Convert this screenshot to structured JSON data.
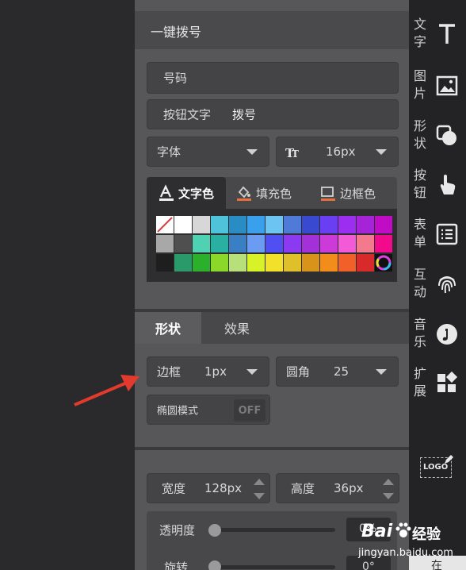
{
  "panel": {
    "title": "一键拨号",
    "number_label": "号码",
    "button_text_label": "按钮文字",
    "button_text_value": "拨号",
    "font_label": "字体",
    "font_size": "16px"
  },
  "color_tabs": [
    {
      "label": "文字色",
      "icon": "text-color-icon"
    },
    {
      "label": "填充色",
      "icon": "fill-color-icon"
    },
    {
      "label": "边框色",
      "icon": "border-color-icon"
    }
  ],
  "palette": {
    "rows": [
      [
        "none",
        "#ffffff",
        "#d7d7d7",
        "#4fc3d9",
        "#2a8cc4",
        "#3aa0ec",
        "#6cc4f2",
        "#4f7ad8",
        "#3a4ad0",
        "#6a3ef2",
        "#9c2ef2",
        "#a624d8",
        "#c00cc4"
      ],
      [
        "#a8a8a8",
        "#4f4f4f",
        "#4fd2b2",
        "#2ab0a0",
        "#3a7ec4",
        "#6c9cf2",
        "#5050f2",
        "#8c3af2",
        "#a430d8",
        "#cc3ad8",
        "#f25ad8",
        "#f27a8c",
        "#f20a8c"
      ],
      [
        "#1e1e1e",
        "#2a9a6a",
        "#2ab02a",
        "#8cd82a",
        "#b8e07a",
        "#d8f22a",
        "#f2e02a",
        "#e0c02a",
        "#d8941a",
        "#f28c1a",
        "#f2602a",
        "#d82a2a",
        "wheel"
      ]
    ]
  },
  "shape_tabs": [
    {
      "label": "形状"
    },
    {
      "label": "效果"
    }
  ],
  "shape": {
    "border_label": "边框",
    "border_value": "1px",
    "radius_label": "圆角",
    "radius_value": "25",
    "ellipse_label": "椭圆模式",
    "ellipse_toggle": "OFF"
  },
  "size": {
    "width_label": "宽度",
    "width_value": "128px",
    "height_label": "高度",
    "height_value": "36px"
  },
  "sliders": {
    "opacity_label": "透明度",
    "opacity_value": "0%",
    "rotate_label": "旋转",
    "rotate_value": "0°"
  },
  "rail": [
    {
      "label": "文字",
      "icon": "text-icon"
    },
    {
      "label": "图片",
      "icon": "image-icon"
    },
    {
      "label": "形状",
      "icon": "shape-icon"
    },
    {
      "label": "按钮",
      "icon": "button-tap-icon"
    },
    {
      "label": "表单",
      "icon": "form-icon"
    },
    {
      "label": "互动",
      "icon": "fingerprint-icon"
    },
    {
      "label": "音乐",
      "icon": "music-icon"
    },
    {
      "label": "扩展",
      "icon": "extend-icon"
    }
  ],
  "logo_label": "LOGO",
  "watermark": {
    "brand": "Bai",
    "brand2": "经验",
    "url": "jingyan.baidu.com"
  },
  "cut_text": "在",
  "colors": {
    "panel_bg": "#57575a",
    "rail_bg": "#232326",
    "arrow": "#e23a2c"
  }
}
